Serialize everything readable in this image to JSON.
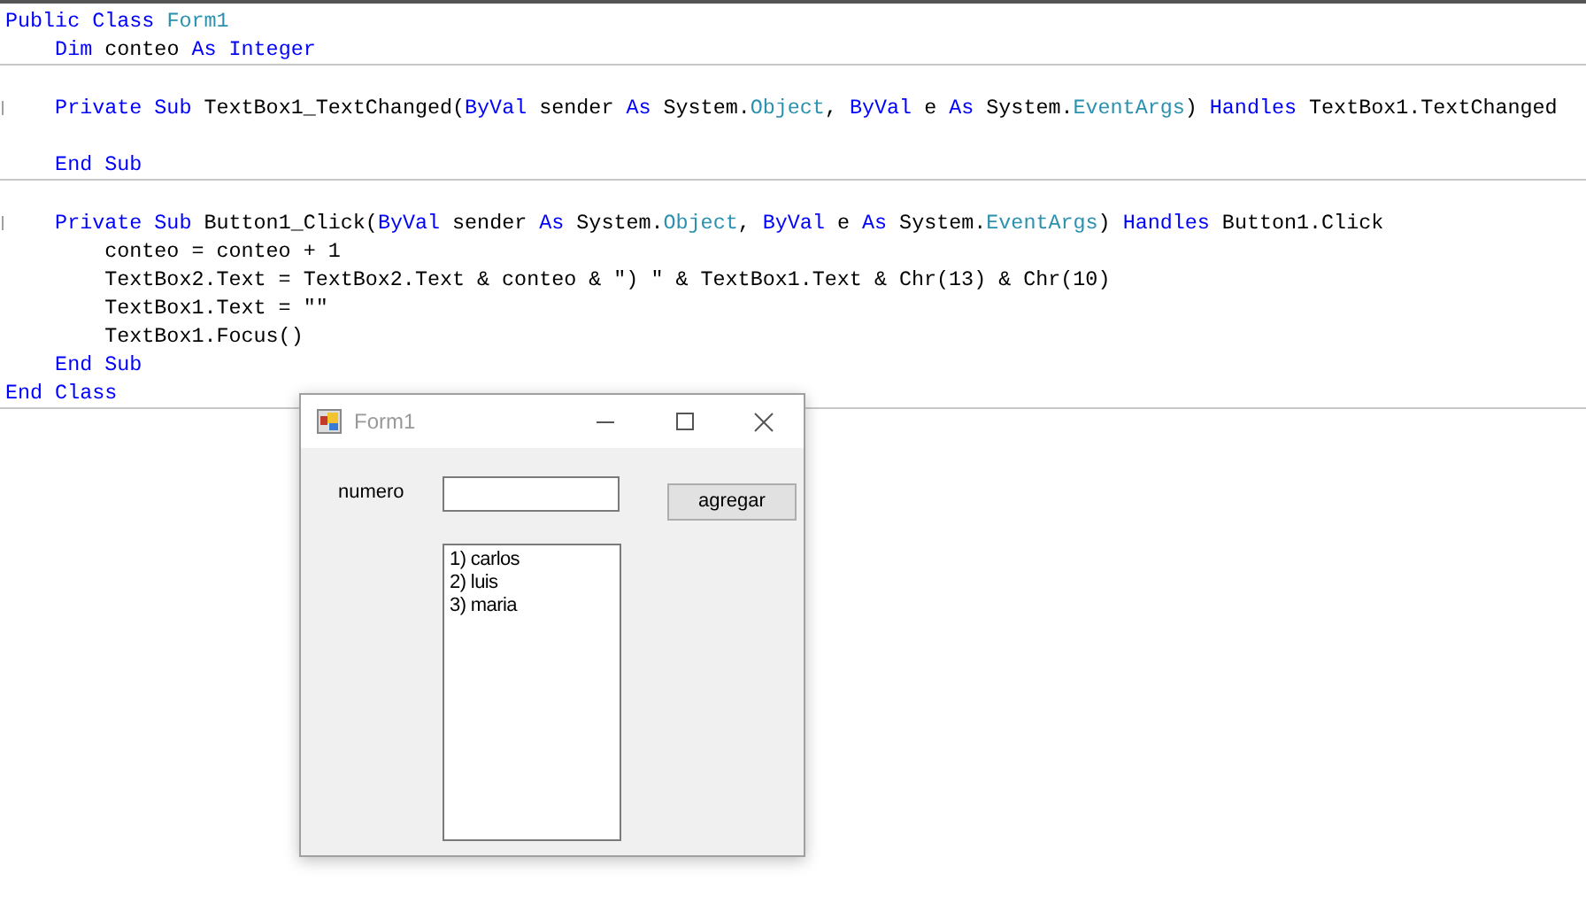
{
  "editor": {
    "blocks": [
      [
        {
          "kind": "code",
          "marker": false,
          "tokens": [
            {
              "kind": "keyword",
              "text": "Public Class "
            },
            {
              "kind": "type",
              "text": "Form1"
            }
          ]
        },
        {
          "kind": "code",
          "marker": false,
          "tokens": [
            {
              "kind": "keyword",
              "text": "    Dim"
            },
            {
              "kind": "plain",
              "text": " conteo "
            },
            {
              "kind": "keyword",
              "text": "As Integer"
            }
          ]
        }
      ],
      [
        {
          "kind": "blank",
          "marker": false
        },
        {
          "kind": "code",
          "marker": true,
          "tokens": [
            {
              "kind": "keyword",
              "text": "    Private Sub"
            },
            {
              "kind": "plain",
              "text": " TextBox1_TextChanged("
            },
            {
              "kind": "keyword",
              "text": "ByVal"
            },
            {
              "kind": "plain",
              "text": " sender "
            },
            {
              "kind": "keyword",
              "text": "As"
            },
            {
              "kind": "plain",
              "text": " System."
            },
            {
              "kind": "type",
              "text": "Object"
            },
            {
              "kind": "plain",
              "text": ", "
            },
            {
              "kind": "keyword",
              "text": "ByVal"
            },
            {
              "kind": "plain",
              "text": " e "
            },
            {
              "kind": "keyword",
              "text": "As"
            },
            {
              "kind": "plain",
              "text": " System."
            },
            {
              "kind": "type",
              "text": "EventArgs"
            },
            {
              "kind": "plain",
              "text": ") "
            },
            {
              "kind": "keyword",
              "text": "Handles"
            },
            {
              "kind": "plain",
              "text": " TextBox1.TextChanged"
            }
          ]
        },
        {
          "kind": "blank",
          "marker": false
        },
        {
          "kind": "code",
          "marker": false,
          "tokens": [
            {
              "kind": "keyword",
              "text": "    End Sub"
            }
          ]
        }
      ],
      [
        {
          "kind": "blank",
          "marker": false
        },
        {
          "kind": "code",
          "marker": true,
          "tokens": [
            {
              "kind": "keyword",
              "text": "    Private Sub"
            },
            {
              "kind": "plain",
              "text": " Button1_Click("
            },
            {
              "kind": "keyword",
              "text": "ByVal"
            },
            {
              "kind": "plain",
              "text": " sender "
            },
            {
              "kind": "keyword",
              "text": "As"
            },
            {
              "kind": "plain",
              "text": " System."
            },
            {
              "kind": "type",
              "text": "Object"
            },
            {
              "kind": "plain",
              "text": ", "
            },
            {
              "kind": "keyword",
              "text": "ByVal"
            },
            {
              "kind": "plain",
              "text": " e "
            },
            {
              "kind": "keyword",
              "text": "As"
            },
            {
              "kind": "plain",
              "text": " System."
            },
            {
              "kind": "type",
              "text": "EventArgs"
            },
            {
              "kind": "plain",
              "text": ") "
            },
            {
              "kind": "keyword",
              "text": "Handles"
            },
            {
              "kind": "plain",
              "text": " Button1.Click"
            }
          ]
        },
        {
          "kind": "code",
          "marker": false,
          "tokens": [
            {
              "kind": "plain",
              "text": "        conteo = conteo + 1"
            }
          ]
        },
        {
          "kind": "code",
          "marker": false,
          "tokens": [
            {
              "kind": "plain",
              "text": "        TextBox2.Text = TextBox2.Text & conteo & \") \" & TextBox1.Text & Chr(13) & Chr(10)"
            }
          ]
        },
        {
          "kind": "code",
          "marker": false,
          "tokens": [
            {
              "kind": "plain",
              "text": "        TextBox1.Text = \"\""
            }
          ]
        },
        {
          "kind": "code",
          "marker": false,
          "tokens": [
            {
              "kind": "plain",
              "text": "        TextBox1.Focus()"
            }
          ]
        },
        {
          "kind": "code",
          "marker": false,
          "tokens": [
            {
              "kind": "keyword",
              "text": "    End Sub"
            }
          ]
        },
        {
          "kind": "code",
          "marker": false,
          "tokens": [
            {
              "kind": "keyword",
              "text": "End Class"
            }
          ]
        }
      ]
    ]
  },
  "form": {
    "title": "Form1",
    "label": "numero",
    "button": "agregar",
    "output_lines": [
      "1) carlos",
      "2) luis",
      "3) maria"
    ]
  }
}
